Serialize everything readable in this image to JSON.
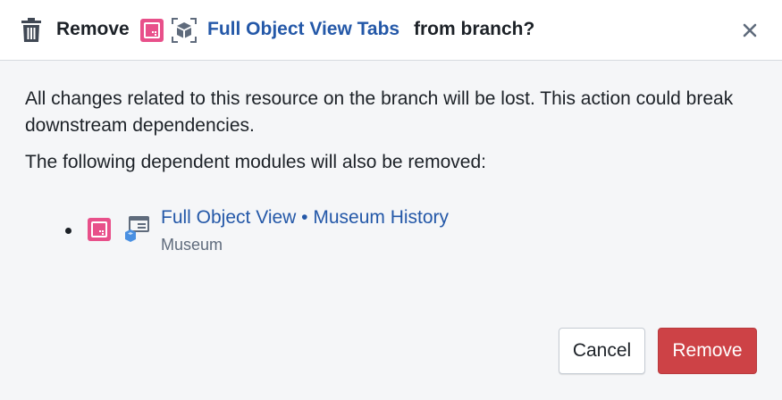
{
  "header": {
    "prefix": "Remove",
    "resource_name": "Full Object View Tabs",
    "suffix": "from branch?",
    "icons": [
      "trash-icon",
      "pink-module-icon",
      "object-cube-icon",
      "close-icon"
    ]
  },
  "body": {
    "warning": "All changes related to this resource on the branch will be lost. This action could break downstream dependencies.",
    "dependents_intro": "The following dependent modules will also be removed:",
    "dependents": [
      {
        "title": "Full Object View • Museum History",
        "subtitle": "Museum",
        "icons": [
          "pink-module-icon",
          "object-view-icon"
        ]
      }
    ]
  },
  "footer": {
    "cancel_label": "Cancel",
    "remove_label": "Remove"
  },
  "colors": {
    "link": "#2458a8",
    "danger": "#cd4246",
    "module_pink": "#e8508a",
    "object_blue": "#4a90e2",
    "background": "#f5f6f8"
  }
}
